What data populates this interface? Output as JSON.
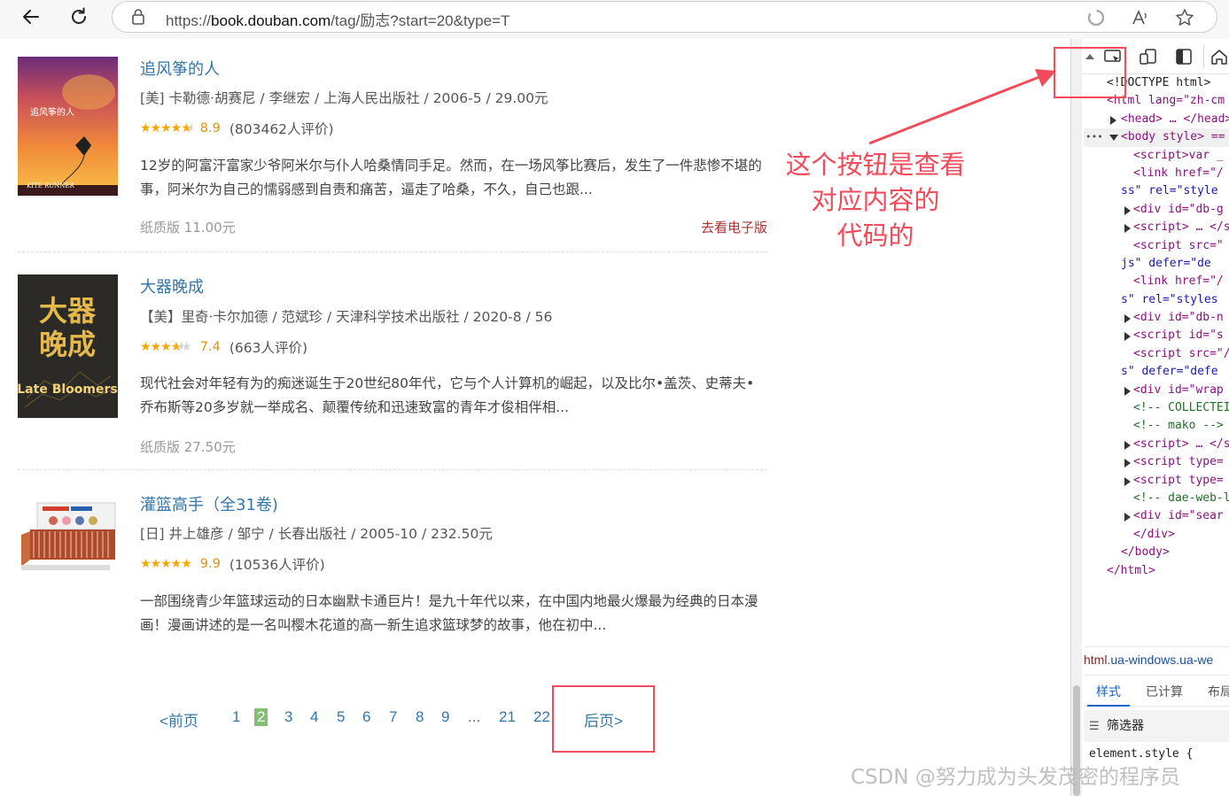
{
  "browser": {
    "url_prefix": "https://",
    "url_host": "book.douban.com",
    "url_path": "/tag/励志?start=20&type=T",
    "back_icon": "back-arrow-icon",
    "refresh_icon": "refresh-icon",
    "lock_icon": "lock-icon",
    "read_aloud_icon": "read-aloud-icon",
    "favorite_icon": "star-outline-icon"
  },
  "books": [
    {
      "title": "追风筝的人",
      "pub": "[美] 卡勒德·胡赛尼 / 李继宏 / 上海人民出版社 / 2006-5 / 29.00元",
      "stars": 4.5,
      "score": "8.9",
      "votes": "(803462人评价)",
      "desc": "12岁的阿富汗富家少爷阿米尔与仆人哈桑情同手足。然而，在一场风筝比赛后，发生了一件悲惨不堪的事，阿米尔为自己的懦弱感到自责和痛苦，逼走了哈桑，不久，自己也跟...",
      "price": "纸质版 11.00元",
      "ebook": "去看电子版",
      "cover_title": "追风筝的人",
      "cover_subtitle": "KITE RUNNER"
    },
    {
      "title": "大器晚成",
      "pub": "【美】里奇·卡尔加德 / 范斌珍 / 天津科学技术出版社 / 2020-8 / 56",
      "stars": 3.5,
      "score": "7.4",
      "votes": "(663人评价)",
      "desc": "现代社会对年轻有为的痴迷诞生于20世纪80年代，它与个人计算机的崛起，以及比尔•盖茨、史蒂夫•乔布斯等20多岁就一举成名、颠覆传统和迅速致富的青年才俊相伴相...",
      "price": "纸质版 27.50元",
      "cover_title_1": "大器",
      "cover_title_2": "晚成",
      "cover_subtitle": "Late Bloomers"
    },
    {
      "title": "灌篮高手（全31卷)",
      "pub": "[日] 井上雄彦 / 邹宁 / 长春出版社 / 2005-10 / 232.50元",
      "stars": 5,
      "score": "9.9",
      "votes": "(10536人评价)",
      "desc": "一部围绕青少年篮球运动的日本幽默卡通巨片！是九十年代以来，在中国内地最火爆最为经典的日本漫画！漫画讲述的是一名叫樱木花道的高一新生追求篮球梦的故事，他在初中..."
    }
  ],
  "pager": {
    "prev": "<前页",
    "pages": [
      "1",
      "2",
      "3",
      "4",
      "5",
      "6",
      "7",
      "8",
      "9"
    ],
    "current": "2",
    "dots": "...",
    "tail": [
      "21",
      "22"
    ],
    "next": "后页>"
  },
  "devtools": {
    "tab_icons": [
      "inspect-icon",
      "device-toolbar-icon",
      "dock-icon",
      "home-icon"
    ],
    "lines": [
      {
        "text": "<!DOCTYPE html>",
        "kind": "doctype"
      },
      {
        "text": "<html lang=\"zh-cm",
        "kind": "tag"
      },
      {
        "text": "<head> … </head>",
        "kind": "tag"
      },
      {
        "text": "<body style> ==",
        "kind": "tag"
      },
      {
        "text": "<script>var _",
        "kind": "tag"
      },
      {
        "text": "<link href=\"/",
        "kind": "tag"
      },
      {
        "text": "ss\" rel=\"style",
        "kind": "tag"
      },
      {
        "text": "<div id=\"db-g",
        "kind": "tag"
      },
      {
        "text": "<script> … </s",
        "kind": "tag"
      },
      {
        "text": "<script src=\"",
        "kind": "tag"
      },
      {
        "text": "js\" defer=\"de",
        "kind": "tag"
      },
      {
        "text": "<link href=\"/",
        "kind": "tag"
      },
      {
        "text": "s\" rel=\"styles",
        "kind": "tag"
      },
      {
        "text": "<div id=\"db-n",
        "kind": "tag"
      },
      {
        "text": "<script id=\"s",
        "kind": "tag"
      },
      {
        "text": "<script src=\"/",
        "kind": "tag"
      },
      {
        "text": "s\" defer=\"defe",
        "kind": "tag"
      },
      {
        "text": "<div id=\"wrap",
        "kind": "tag"
      },
      {
        "text": "<!-- COLLECTEI",
        "kind": "comment"
      },
      {
        "text": "<!-- mako -->",
        "kind": "comment"
      },
      {
        "text": "<script> … </s",
        "kind": "tag"
      },
      {
        "text": "<script type=",
        "kind": "tag"
      },
      {
        "text": "<script type=",
        "kind": "tag"
      },
      {
        "text": "<!-- dae-web-l",
        "kind": "comment"
      },
      {
        "text": "<div id=\"sear",
        "kind": "tag"
      },
      {
        "text": "</div>",
        "kind": "tag"
      },
      {
        "text": "</body>",
        "kind": "tag"
      },
      {
        "text": "</html>",
        "kind": "tag"
      }
    ],
    "breadcrumb_tag": "html",
    "breadcrumb_class": ".ua-windows.ua-we",
    "styles_tabs": [
      "样式",
      "已计算",
      "布局"
    ],
    "filter_label": "筛选器",
    "element_style": "element.style {"
  },
  "annotation": {
    "text_lines": [
      "这个按钮是查看",
      "对应内容的",
      "代码的"
    ],
    "color": "#f24b5b"
  },
  "watermark": "CSDN @努力成为头发茂密的程序员"
}
